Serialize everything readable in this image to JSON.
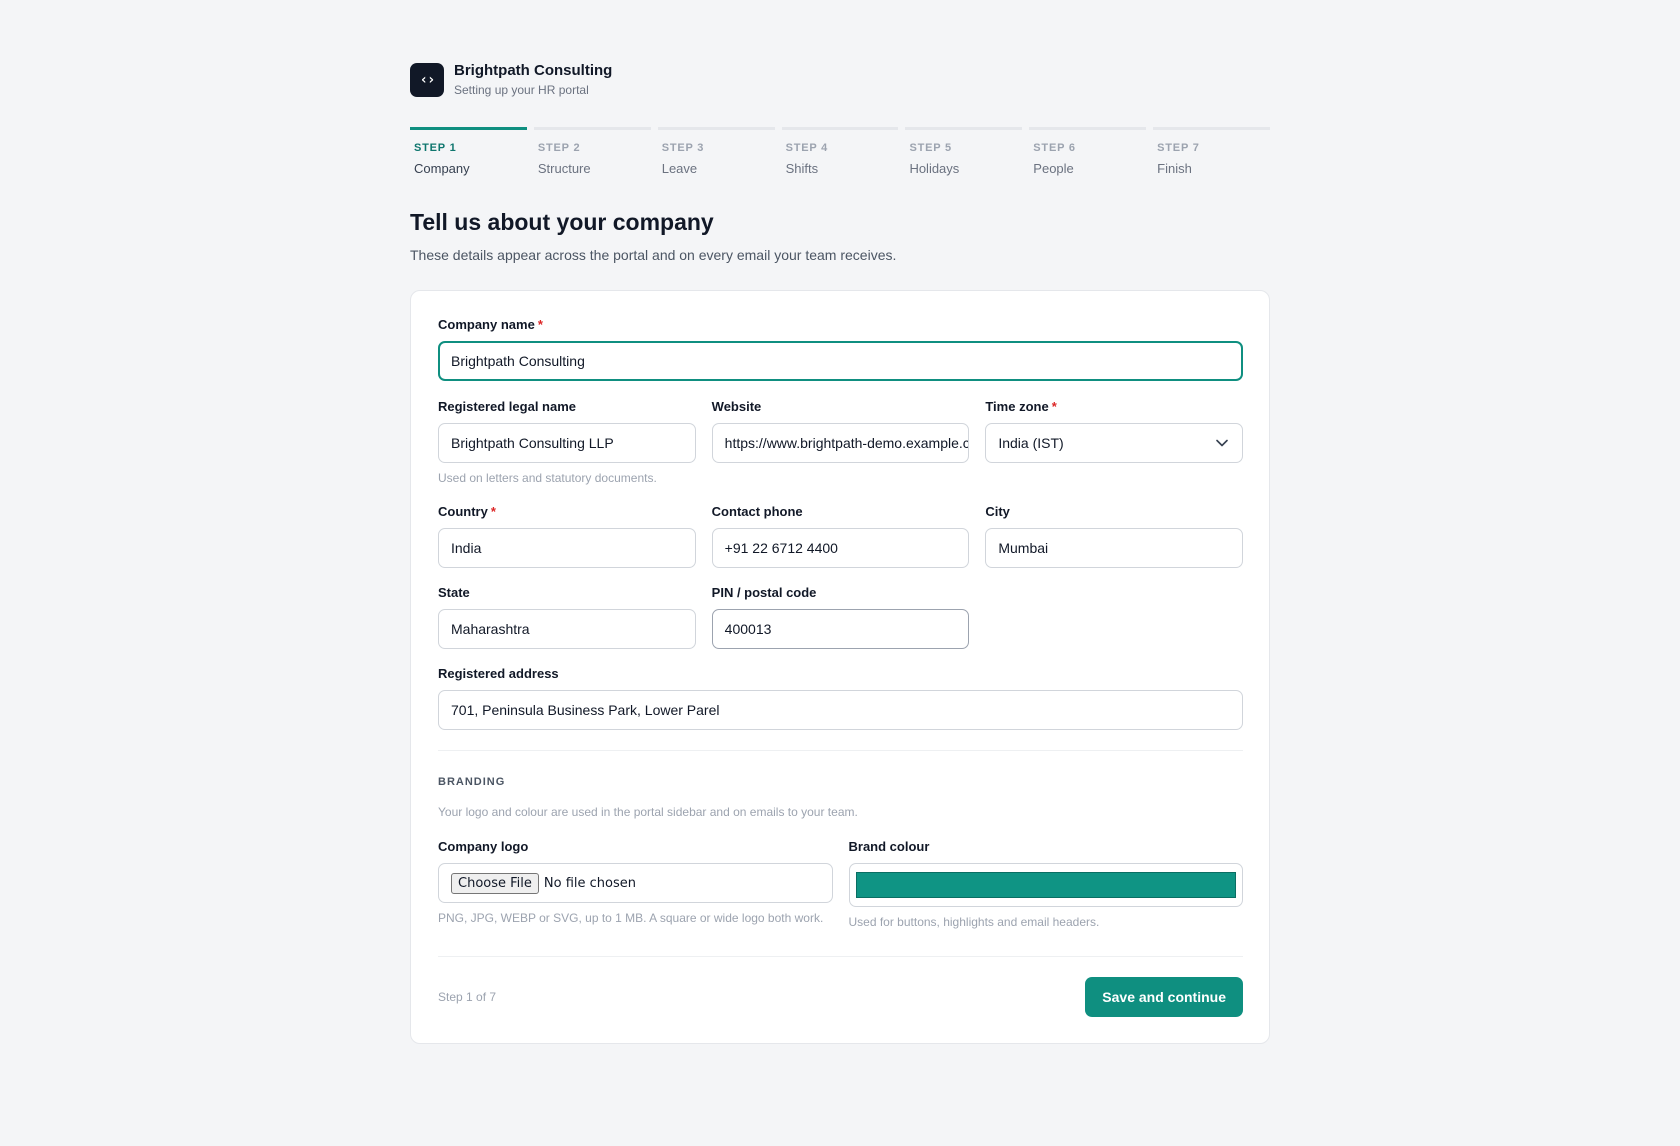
{
  "brand": {
    "logo_glyph": "‹›",
    "name": "Brightpath Consulting",
    "subtitle": "Setting up your HR portal"
  },
  "steps": [
    {
      "num": "STEP 1",
      "name": "Company",
      "active": true
    },
    {
      "num": "STEP 2",
      "name": "Structure",
      "active": false
    },
    {
      "num": "STEP 3",
      "name": "Leave",
      "active": false
    },
    {
      "num": "STEP 4",
      "name": "Shifts",
      "active": false
    },
    {
      "num": "STEP 5",
      "name": "Holidays",
      "active": false
    },
    {
      "num": "STEP 6",
      "name": "People",
      "active": false
    },
    {
      "num": "STEP 7",
      "name": "Finish",
      "active": false
    }
  ],
  "page": {
    "title": "Tell us about your company",
    "description": "These details appear across the portal and on every email your team receives."
  },
  "form": {
    "company_name": {
      "label": "Company name",
      "required_mark": "*",
      "value": "Brightpath Consulting"
    },
    "legal_name": {
      "label": "Registered legal name",
      "value": "Brightpath Consulting LLP",
      "hint": "Used on letters and statutory documents."
    },
    "website": {
      "label": "Website",
      "value": "https://www.brightpath-demo.example.com"
    },
    "timezone": {
      "label": "Time zone",
      "required_mark": "*",
      "value": "India (IST)",
      "icon": "chevron-down-icon"
    },
    "country": {
      "label": "Country",
      "required_mark": "*",
      "value": "India"
    },
    "phone": {
      "label": "Contact phone",
      "value": "+91 22 6712 4400"
    },
    "city": {
      "label": "City",
      "value": "Mumbai"
    },
    "state": {
      "label": "State",
      "value": "Maharashtra"
    },
    "pin": {
      "label": "PIN / postal code",
      "value": "400013"
    },
    "address": {
      "label": "Registered address",
      "value": "701, Peninsula Business Park, Lower Parel"
    }
  },
  "branding": {
    "title": "BRANDING",
    "description": "Your logo and colour are used in the portal sidebar and on emails to your team.",
    "logo": {
      "label": "Company logo",
      "button": "Choose File",
      "status": "No file chosen",
      "hint": "PNG, JPG, WEBP or SVG, up to 1 MB. A square or wide logo both work."
    },
    "colour": {
      "label": "Brand colour",
      "value": "#0f9484",
      "hint": "Used for buttons, highlights and email headers."
    }
  },
  "footer": {
    "step_text": "Step 1 of 7",
    "save_label": "Save and continue"
  },
  "colors": {
    "accent": "#0f8f80",
    "required": "#dc2626"
  }
}
